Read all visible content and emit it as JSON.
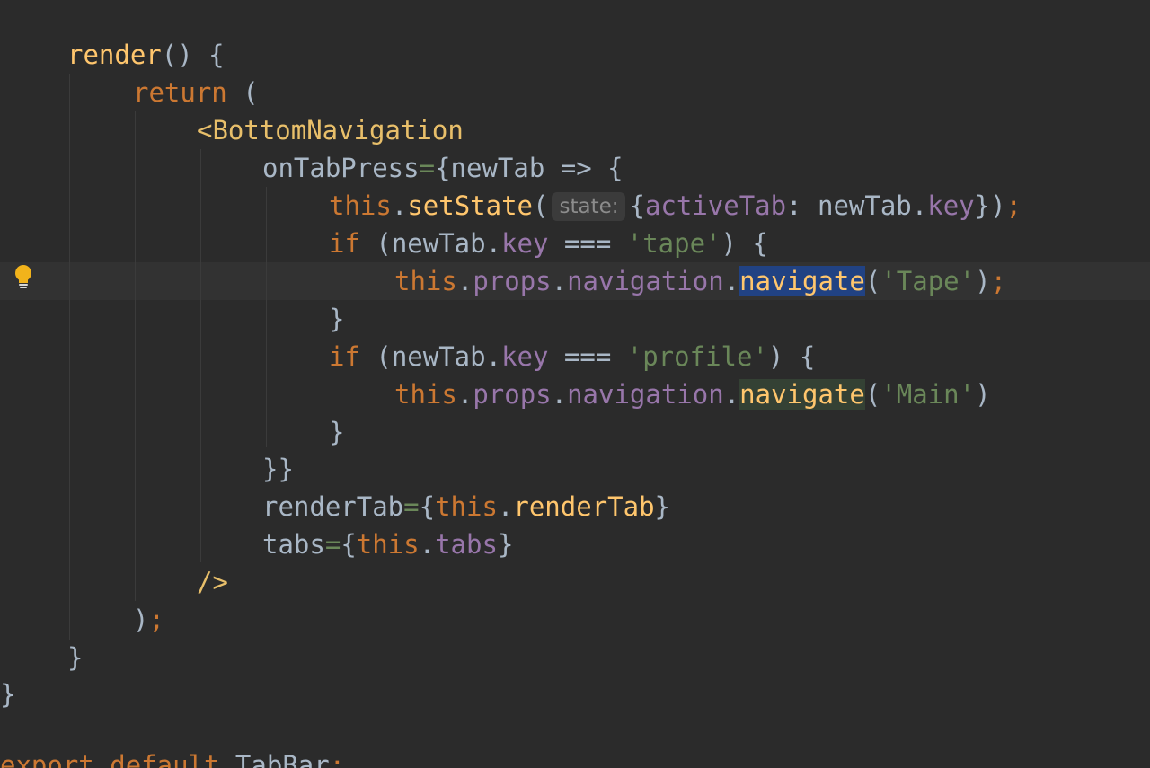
{
  "editor": {
    "lines": [
      {
        "tokens": [
          {
            "text": "render",
            "cls": "t-fn"
          },
          {
            "text": "() {",
            "cls": "t-plain"
          }
        ]
      },
      {
        "tokens": [
          {
            "text": "return",
            "cls": "t-kw"
          },
          {
            "text": " (",
            "cls": "t-plain"
          }
        ]
      },
      {
        "tokens": [
          {
            "text": "<BottomNavigation",
            "cls": "t-tag"
          }
        ]
      },
      {
        "tokens": [
          {
            "text": "onTabPress",
            "cls": "t-plain"
          },
          {
            "text": "=",
            "cls": "t-str"
          },
          {
            "text": "{newTab => {",
            "cls": "t-plain"
          }
        ]
      },
      {
        "tokens": [
          {
            "text": "this",
            "cls": "t-kw"
          },
          {
            "text": ".",
            "cls": "t-plain"
          },
          {
            "text": "setState",
            "cls": "t-fn"
          },
          {
            "text": "(",
            "cls": "t-plain"
          },
          {
            "text": "state:",
            "cls": "hint"
          },
          {
            "text": "{",
            "cls": "t-plain"
          },
          {
            "text": "activeTab",
            "cls": "t-field"
          },
          {
            "text": ": newTab.",
            "cls": "t-plain"
          },
          {
            "text": "key",
            "cls": "t-field"
          },
          {
            "text": "})",
            "cls": "t-plain"
          },
          {
            "text": ";",
            "cls": "t-kw"
          }
        ]
      },
      {
        "tokens": [
          {
            "text": "if",
            "cls": "t-kw"
          },
          {
            "text": " (newTab.",
            "cls": "t-plain"
          },
          {
            "text": "key",
            "cls": "t-field"
          },
          {
            "text": " === ",
            "cls": "t-plain"
          },
          {
            "text": "'tape'",
            "cls": "t-str"
          },
          {
            "text": ") {",
            "cls": "t-plain"
          }
        ]
      },
      {
        "tokens": [
          {
            "text": "this",
            "cls": "t-kw"
          },
          {
            "text": ".",
            "cls": "t-plain"
          },
          {
            "text": "props",
            "cls": "t-field"
          },
          {
            "text": ".",
            "cls": "t-plain"
          },
          {
            "text": "navigation",
            "cls": "t-field"
          },
          {
            "text": ".",
            "cls": "t-plain"
          },
          {
            "text": "navigate",
            "cls": "t-fn hl-sel"
          },
          {
            "text": "(",
            "cls": "t-plain"
          },
          {
            "text": "'Tape'",
            "cls": "t-str"
          },
          {
            "text": ")",
            "cls": "t-plain"
          },
          {
            "text": ";",
            "cls": "t-kw"
          }
        ]
      },
      {
        "tokens": [
          {
            "text": "}",
            "cls": "t-plain"
          }
        ]
      },
      {
        "tokens": [
          {
            "text": "if",
            "cls": "t-kw"
          },
          {
            "text": " (newTab.",
            "cls": "t-plain"
          },
          {
            "text": "key",
            "cls": "t-field"
          },
          {
            "text": " === ",
            "cls": "t-plain"
          },
          {
            "text": "'profile'",
            "cls": "t-str"
          },
          {
            "text": ") {",
            "cls": "t-plain"
          }
        ]
      },
      {
        "tokens": [
          {
            "text": "this",
            "cls": "t-kw"
          },
          {
            "text": ".",
            "cls": "t-plain"
          },
          {
            "text": "props",
            "cls": "t-field"
          },
          {
            "text": ".",
            "cls": "t-plain"
          },
          {
            "text": "navigation",
            "cls": "t-field"
          },
          {
            "text": ".",
            "cls": "t-plain"
          },
          {
            "text": "navigate",
            "cls": "t-fn hl-usage"
          },
          {
            "text": "(",
            "cls": "t-plain"
          },
          {
            "text": "'Main'",
            "cls": "t-str"
          },
          {
            "text": ")",
            "cls": "t-plain"
          }
        ]
      },
      {
        "tokens": [
          {
            "text": "}",
            "cls": "t-plain"
          }
        ]
      },
      {
        "tokens": [
          {
            "text": "}}",
            "cls": "t-plain"
          }
        ]
      },
      {
        "tokens": [
          {
            "text": "renderTab",
            "cls": "t-plain"
          },
          {
            "text": "=",
            "cls": "t-str"
          },
          {
            "text": "{",
            "cls": "t-plain"
          },
          {
            "text": "this",
            "cls": "t-kw"
          },
          {
            "text": ".",
            "cls": "t-plain"
          },
          {
            "text": "renderTab",
            "cls": "t-fn"
          },
          {
            "text": "}",
            "cls": "t-plain"
          }
        ]
      },
      {
        "tokens": [
          {
            "text": "tabs",
            "cls": "t-plain"
          },
          {
            "text": "=",
            "cls": "t-str"
          },
          {
            "text": "{",
            "cls": "t-plain"
          },
          {
            "text": "this",
            "cls": "t-kw"
          },
          {
            "text": ".",
            "cls": "t-plain"
          },
          {
            "text": "tabs",
            "cls": "t-field"
          },
          {
            "text": "}",
            "cls": "t-plain"
          }
        ]
      },
      {
        "tokens": [
          {
            "text": "/>",
            "cls": "t-tag"
          }
        ]
      },
      {
        "tokens": [
          {
            "text": ")",
            "cls": "t-plain"
          },
          {
            "text": ";",
            "cls": "t-kw"
          }
        ]
      },
      {
        "tokens": [
          {
            "text": "}",
            "cls": "t-plain"
          }
        ]
      },
      {
        "tokens": [
          {
            "text": "}",
            "cls": "t-plain"
          }
        ]
      },
      {
        "tokens": []
      },
      {
        "tokens": [
          {
            "text": "export",
            "cls": "t-kw"
          },
          {
            "text": " ",
            "cls": "t-plain"
          },
          {
            "text": "default",
            "cls": "t-kw"
          },
          {
            "text": " TabBar",
            "cls": "t-plain"
          },
          {
            "text": ";",
            "cls": "t-kw"
          }
        ]
      }
    ]
  },
  "gutter": {
    "intention_icon": "lightbulb-icon"
  },
  "colors": {
    "background": "#2b2b2b",
    "keyword": "#cc7832",
    "function": "#ffc66d",
    "field": "#9876aa",
    "string": "#6a8759",
    "tag": "#e8bf6a",
    "text": "#a9b7c6",
    "selection": "#214283",
    "usage_highlight": "#344134"
  }
}
